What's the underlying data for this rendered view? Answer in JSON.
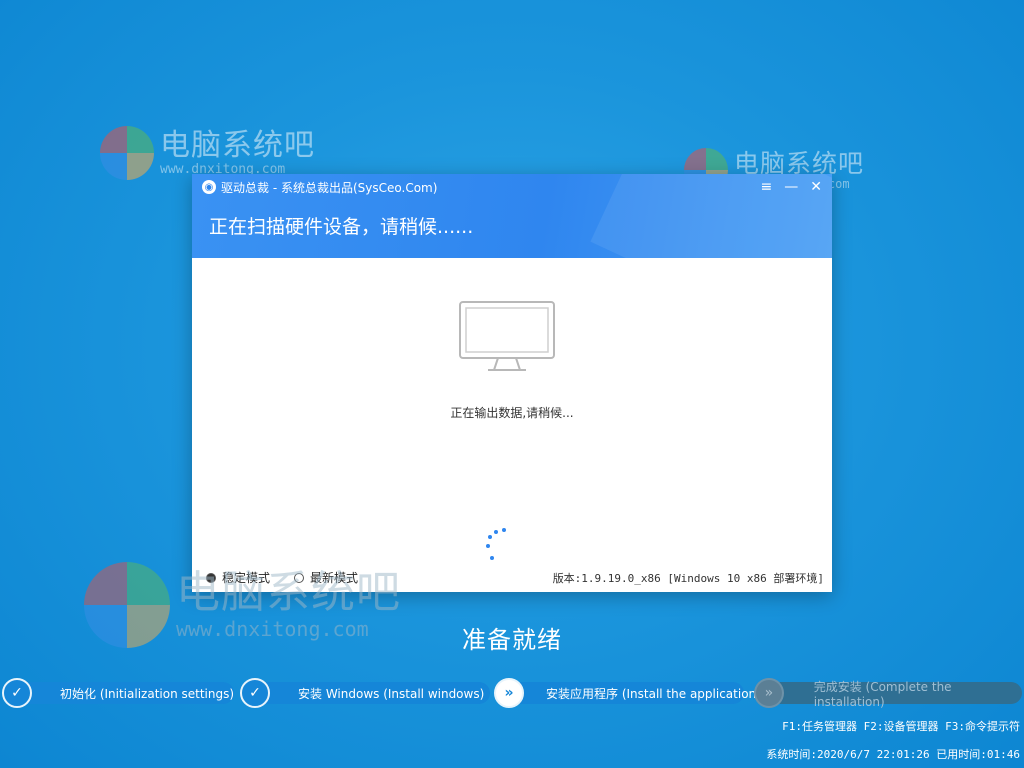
{
  "watermark": {
    "text": "电脑系统吧",
    "url": "www.dnxitong.com"
  },
  "window": {
    "title": "驱动总裁 - 系统总裁出品(SysCeo.Com)",
    "controls": {
      "menu": "≡",
      "minimize": "—",
      "close": "✕"
    },
    "header_message": "正在扫描硬件设备，请稍候......",
    "scan_message": "正在输出数据,请稍候...",
    "modes": [
      {
        "label": "稳定模式",
        "selected": true
      },
      {
        "label": "最新模式",
        "selected": false
      }
    ],
    "version": "版本:1.9.19.0_x86 [Windows 10 x86 部署环境]"
  },
  "status": "准备就绪",
  "steps": [
    {
      "label": "初始化 (Initialization settings)",
      "state": "done",
      "icon": "check-icon"
    },
    {
      "label": "安装 Windows (Install windows)",
      "state": "done",
      "icon": "check-icon"
    },
    {
      "label": "安装应用程序 (Install the application)",
      "state": "active",
      "icon": "double-chevron-icon"
    },
    {
      "label": "完成安装 (Complete the installation)",
      "state": "pending",
      "icon": "double-chevron-icon"
    }
  ],
  "footer": {
    "fkeys": "F1:任务管理器 F2:设备管理器 F3:命令提示符",
    "clock": "系统时间:2020/6/7 22:01:26 已用时间:01:46"
  },
  "colors": {
    "accent": "#2f86ef",
    "background": "#1b95dc"
  }
}
